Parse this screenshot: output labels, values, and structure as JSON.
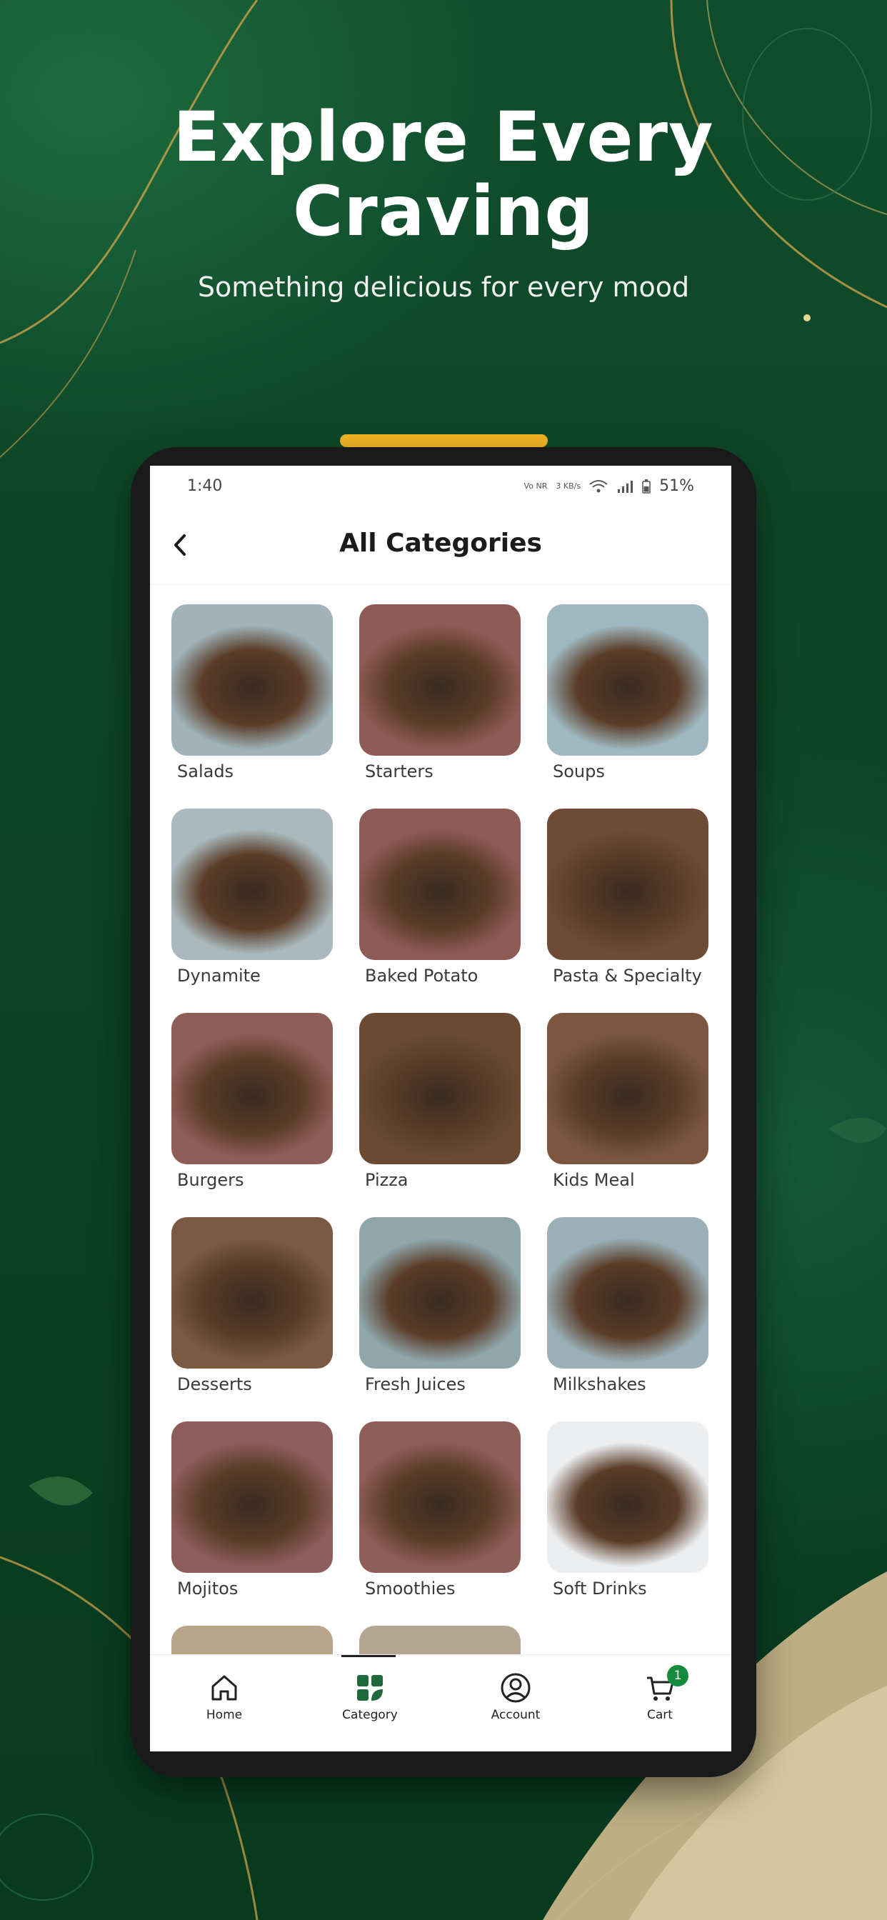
{
  "hero": {
    "title_line1": "Explore Every",
    "title_line2": "Craving",
    "subtitle": "Something delicious for every mood"
  },
  "status_bar": {
    "time": "1:40",
    "network": "Vo NR",
    "speed": "3 KB/s",
    "battery": "51%"
  },
  "header": {
    "title": "All Categories",
    "back_icon": "chevron-left-icon"
  },
  "categories": [
    {
      "label": "Salads",
      "bg": "#9fb3b8"
    },
    {
      "label": "Starters",
      "bg": "#8f5b55"
    },
    {
      "label": "Soups",
      "bg": "#9fb7be"
    },
    {
      "label": "Dynamite",
      "bg": "#a9b9bd"
    },
    {
      "label": "Baked Potato",
      "bg": "#8e5a56"
    },
    {
      "label": "Pasta & Specialty",
      "bg": "#6e4b37"
    },
    {
      "label": "Burgers",
      "bg": "#8f5d58"
    },
    {
      "label": "Pizza",
      "bg": "#6a4a33"
    },
    {
      "label": "Kids Meal",
      "bg": "#7a5640"
    },
    {
      "label": "Desserts",
      "bg": "#7b5a44"
    },
    {
      "label": "Fresh Juices",
      "bg": "#8fa6ab"
    },
    {
      "label": "Milkshakes",
      "bg": "#9ab0b6"
    },
    {
      "label": "Mojitos",
      "bg": "#8c5d5a"
    },
    {
      "label": "Smoothies",
      "bg": "#8e5d58"
    },
    {
      "label": "Soft Drinks",
      "bg": "#eceef0"
    }
  ],
  "partial_row_bgs": [
    "#b9a58a",
    "#b6a691"
  ],
  "bottom_nav": {
    "home": "Home",
    "category": "Category",
    "account": "Account",
    "cart": "Cart",
    "cart_count": "1"
  },
  "colors": {
    "accent_green": "#138a3c",
    "pill_gold": "#f2b524",
    "background_green": "#0f4d2c"
  }
}
